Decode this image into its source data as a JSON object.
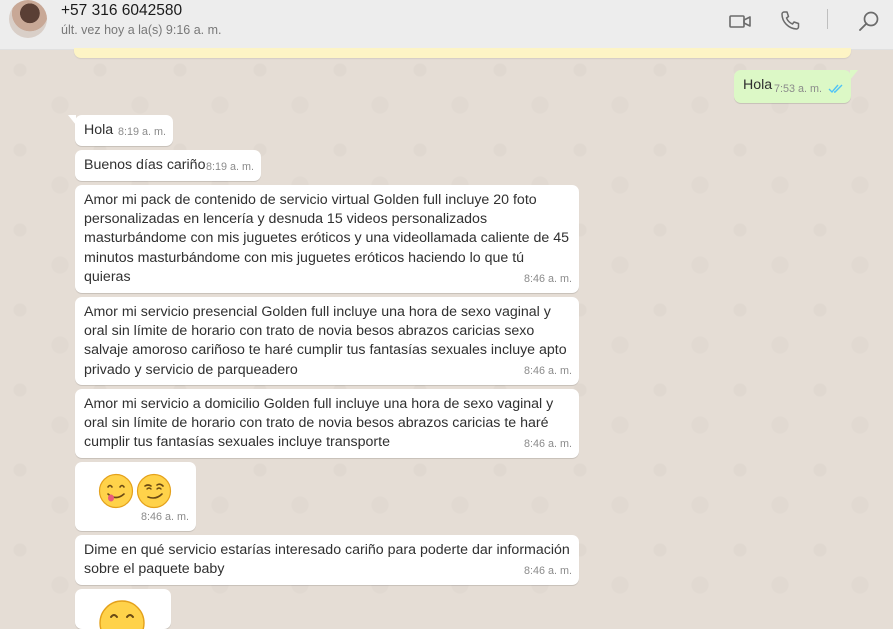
{
  "header": {
    "contact_name": "+57 316 6042580",
    "last_seen": "últ. vez hoy a la(s) 9:16 a. m.",
    "icons": [
      "video-call-icon",
      "voice-call-icon",
      "search-icon"
    ]
  },
  "messages": [
    {
      "direction": "out",
      "text": "Hola",
      "time": "7:53 a. m.",
      "status": "read"
    },
    {
      "direction": "in",
      "text": "Hola",
      "time": "8:19 a. m."
    },
    {
      "direction": "in",
      "text": "Buenos días cariño",
      "time": "8:19 a. m."
    },
    {
      "direction": "in",
      "lines": [
        "Amor mi pack de contenido de servicio virtual Golden full incluye 20 foto",
        "personalizadas en lencería y desnuda 15 videos personalizados",
        "masturbándome con mis juguetes eróticos y una videollamada caliente de 45",
        "minutos masturbándome con mis juguetes eróticos haciendo lo que tú",
        "quieras"
      ],
      "time": "8:46 a. m."
    },
    {
      "direction": "in",
      "lines": [
        "Amor mi servicio presencial Golden full incluye una hora de sexo vaginal y",
        "oral sin límite de horario con trato de novia besos abrazos caricias sexo",
        "salvaje amoroso cariñoso te haré cumplir tus fantasías sexuales incluye apto",
        "privado y servicio de parqueadero"
      ],
      "time": "8:46 a. m."
    },
    {
      "direction": "in",
      "lines": [
        "Amor mi servicio a domicilio Golden full incluye una hora de sexo vaginal y",
        "oral sin límite de horario con trato de novia besos abrazos caricias te haré",
        "cumplir tus fantasías sexuales incluye transporte"
      ],
      "time": "8:46 a. m."
    },
    {
      "direction": "in",
      "emoji": [
        "yum-face-icon",
        "smirk-face-icon"
      ],
      "time": "8:46 a. m."
    },
    {
      "direction": "in",
      "lines": [
        "Dime en qué servicio estarías interesado cariño para poderte dar información",
        "sobre el paquete baby"
      ],
      "time": "8:46 a. m."
    },
    {
      "direction": "in",
      "emoji": [
        "smiling-face-icon"
      ],
      "time": ""
    }
  ],
  "colors": {
    "header_bg": "#ededed",
    "chat_bg": "#e5ddd5",
    "outgoing_bubble": "#dcf8c6",
    "incoming_bubble": "#ffffff",
    "read_ticks": "#4fc3f7"
  }
}
